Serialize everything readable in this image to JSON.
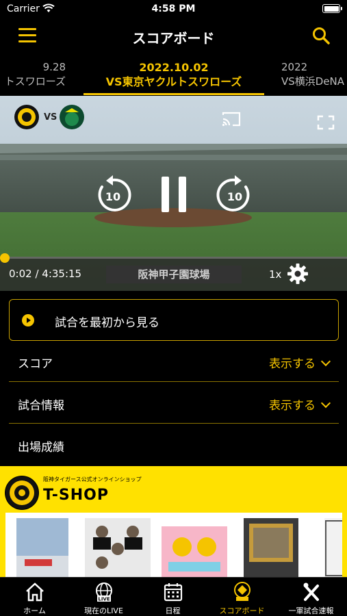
{
  "status_bar": {
    "carrier": "Carrier",
    "time": "4:58 PM"
  },
  "nav": {
    "title": "スコアボード"
  },
  "date_tabs": [
    {
      "date": "9.28",
      "opponent": "トスワローズ"
    },
    {
      "date": "2022.10.02",
      "opponent": "VS東京ヤクルトスワローズ",
      "active": true
    },
    {
      "date": "2022",
      "opponent": "VS横浜DeNA"
    }
  ],
  "video": {
    "vs_text": "VS",
    "time": "0:02 / 4:35:15",
    "venue": "阪神甲子園球場",
    "speed": "1x",
    "progress": 0.0001
  },
  "start_button": {
    "label": "試合を最初から見る"
  },
  "sections": [
    {
      "label": "スコア",
      "action": "表示する"
    },
    {
      "label": "試合情報",
      "action": "表示する"
    },
    {
      "label": "出場成績",
      "action": ""
    }
  ],
  "shop": {
    "subtitle": "阪神タイガース公式オンラインショップ",
    "title": "T-SHOP"
  },
  "tabs": [
    {
      "label": "ホーム",
      "icon": "home-icon"
    },
    {
      "label": "現在のLIVE",
      "icon": "live-globe-icon"
    },
    {
      "label": "日程",
      "icon": "calendar-icon"
    },
    {
      "label": "スコアボード",
      "icon": "scoreboard-icon",
      "active": true
    },
    {
      "label": "一軍試合速報",
      "icon": "baseball-bat-icon"
    }
  ],
  "colors": {
    "accent": "#f5c400",
    "background": "#000000"
  }
}
